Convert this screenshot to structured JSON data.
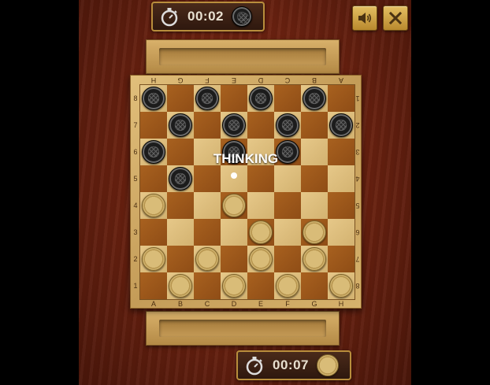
{
  "timers": {
    "top": {
      "time": "00:02",
      "piece_color": "black"
    },
    "bottom": {
      "time": "00:07",
      "piece_color": "white"
    }
  },
  "status_text": "THINKING",
  "controls": {
    "sound_icon": "speaker-icon",
    "close_icon": "close-x-icon"
  },
  "board": {
    "files": [
      "A",
      "B",
      "C",
      "D",
      "E",
      "F",
      "G",
      "H"
    ],
    "ranks": [
      "1",
      "2",
      "3",
      "4",
      "5",
      "6",
      "7",
      "8"
    ],
    "rows_top_to_bottom": [
      "B.B.B.B.",
      ".B.B.B.B",
      "B..B.B..",
      ".B......",
      "W..W....",
      "....W.W.",
      "W.W.W.W.",
      ".W.W.W.W"
    ]
  },
  "colors": {
    "light_square": "#dcbd7c",
    "dark_square": "#9a5619",
    "background_wood": "#6e2311",
    "frame": "#d2ad68"
  }
}
